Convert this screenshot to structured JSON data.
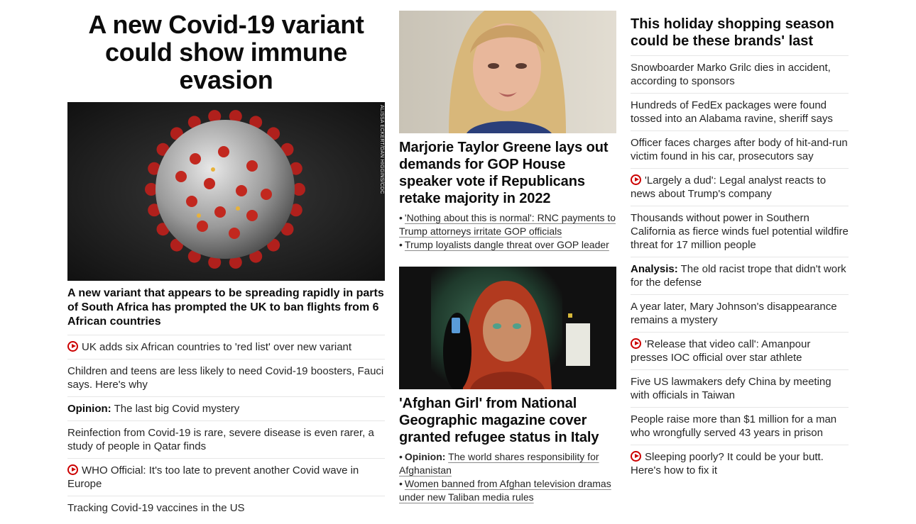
{
  "col1": {
    "headline": "A new Covid-19 variant could show immune evasion",
    "image_credit": "ALISSA ECKERT/DAN HIGGINS/CDC",
    "caption": "A new variant that appears to be spreading rapidly in parts of South Africa has prompted the UK to ban flights from 6 African countries",
    "items": [
      {
        "video": true,
        "prefix": "",
        "text": "UK adds six African countries to 'red list' over new variant"
      },
      {
        "video": false,
        "prefix": "",
        "text": "Children and teens are less likely to need Covid-19 boosters, Fauci says. Here's why"
      },
      {
        "video": false,
        "prefix": "Opinion:",
        "text": "The last big Covid mystery"
      },
      {
        "video": false,
        "prefix": "",
        "text": "Reinfection from Covid-19 is rare, severe disease is even rarer, a study of people in Qatar finds"
      },
      {
        "video": true,
        "prefix": "",
        "text": "WHO Official: It's too late to prevent another Covid wave in Europe"
      },
      {
        "video": false,
        "prefix": "",
        "text": "Tracking Covid-19 vaccines in the US"
      }
    ]
  },
  "col2": {
    "story1": {
      "title": "Marjorie Taylor Greene lays out demands for GOP House speaker vote if Republicans retake majority in 2022",
      "bullets": [
        {
          "prefix": "",
          "text": "'Nothing about this is normal': RNC payments to Trump attorneys irritate GOP officials"
        },
        {
          "prefix": "",
          "text": "Trump loyalists dangle threat over GOP leader"
        }
      ]
    },
    "story2": {
      "title": "'Afghan Girl' from National Geographic magazine cover granted refugee status in Italy",
      "bullets": [
        {
          "prefix": "Opinion:",
          "text": "The world shares responsibility for Afghanistan"
        },
        {
          "prefix": "",
          "text": "Women banned from Afghan television dramas under new Taliban media rules"
        }
      ]
    }
  },
  "col3": {
    "title": "This holiday shopping season could be these brands' last",
    "items": [
      {
        "video": false,
        "prefix": "",
        "text": "Snowboarder Marko Grilc dies in accident, according to sponsors"
      },
      {
        "video": false,
        "prefix": "",
        "text": "Hundreds of FedEx packages were found tossed into an Alabama ravine, sheriff says"
      },
      {
        "video": false,
        "prefix": "",
        "text": "Officer faces charges after body of hit-and-run victim found in his car, prosecutors say"
      },
      {
        "video": true,
        "prefix": "",
        "text": "'Largely a dud': Legal analyst reacts to news about Trump's company"
      },
      {
        "video": false,
        "prefix": "",
        "text": "Thousands without power in Southern California as fierce winds fuel potential wildfire threat for 17 million people"
      },
      {
        "video": false,
        "prefix": "Analysis:",
        "text": "The old racist trope that didn't work for the defense"
      },
      {
        "video": false,
        "prefix": "",
        "text": "A year later, Mary Johnson's disappearance remains a mystery"
      },
      {
        "video": true,
        "prefix": "",
        "text": "'Release that video call': Amanpour presses IOC official over star athlete"
      },
      {
        "video": false,
        "prefix": "",
        "text": "Five US lawmakers defy China by meeting with officials in Taiwan"
      },
      {
        "video": false,
        "prefix": "",
        "text": "People raise more than $1 million for a man who wrongfully served 43 years in prison"
      },
      {
        "video": true,
        "prefix": "",
        "text": "Sleeping poorly? It could be your butt. Here's how to fix it"
      }
    ]
  },
  "colors": {
    "accent_red": "#cc0000",
    "text": "#262626",
    "divider": "#e6e6e6"
  }
}
